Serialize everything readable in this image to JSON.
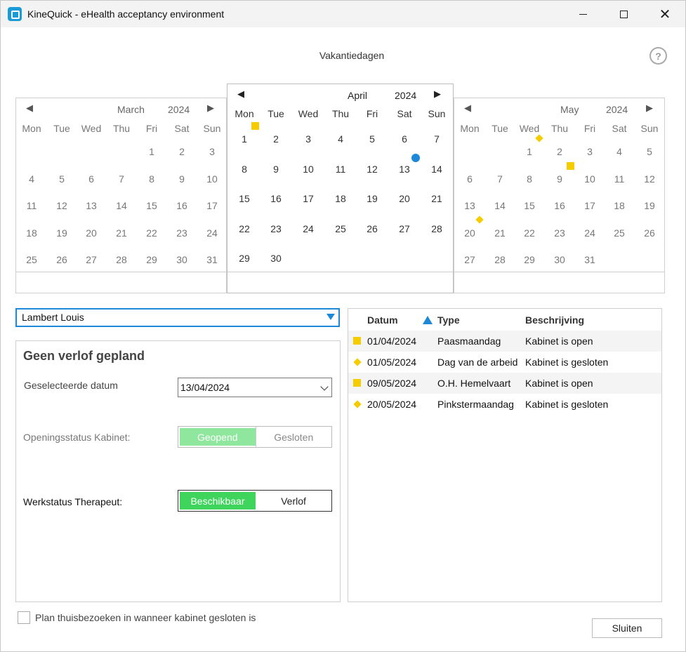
{
  "window": {
    "title": "KineQuick - eHealth acceptancy environment",
    "controls": {
      "minimize": "",
      "maximize": "",
      "close": "✕"
    }
  },
  "dialog": {
    "title": "Vakantiedagen",
    "help": "?"
  },
  "icons": {
    "app": "kinequick-app-icon",
    "help": "question-mark-icon",
    "prev": "triangle-left-icon",
    "next": "triangle-right-icon",
    "dropdown": "triangle-down-icon",
    "sort": "triangle-up-icon"
  },
  "colors": {
    "holiday_open": "#f5cc00",
    "holiday_closed": "#f5cc00",
    "selected_date": "#1e88d8",
    "accent": "#1e88d8",
    "available": "#3fd45c",
    "open_disabled": "#8ee79d"
  },
  "calendar": {
    "prev": "◀",
    "next": "▶",
    "weekdays": [
      "Mon",
      "Tue",
      "Wed",
      "Thu",
      "Fri",
      "Sat",
      "Sun"
    ],
    "months": [
      {
        "month": "March",
        "year": "2024",
        "first_weekday": 4,
        "days": 31,
        "marks": []
      },
      {
        "month": "April",
        "year": "2024",
        "first_weekday": 0,
        "days": 30,
        "marks": [
          {
            "day": 1,
            "kind": "square"
          },
          {
            "day": 13,
            "kind": "dot"
          }
        ]
      },
      {
        "month": "May",
        "year": "2024",
        "first_weekday": 2,
        "days": 31,
        "marks": [
          {
            "day": 1,
            "kind": "diamond"
          },
          {
            "day": 9,
            "kind": "square"
          },
          {
            "day": 20,
            "kind": "diamond"
          }
        ]
      }
    ]
  },
  "therapist": {
    "selected": "Lambert Louis"
  },
  "detail": {
    "heading": "Geen verlof gepland",
    "selected_date_label": "Geselecteerde datum",
    "selected_date_value": "13/04/2024",
    "opening_label": "Openingsstatus Kabinet:",
    "opening_on": "Geopend",
    "opening_off": "Gesloten",
    "work_label": "Werkstatus Therapeut:",
    "work_on": "Beschikbaar",
    "work_off": "Verlof"
  },
  "table": {
    "headers": {
      "date": "Datum",
      "type": "Type",
      "description": "Beschrijving"
    },
    "rows": [
      {
        "mark": "square",
        "date": "01/04/2024",
        "type": "Paasmaandag",
        "description": "Kabinet is open"
      },
      {
        "mark": "diamond",
        "date": "01/05/2024",
        "type": "Dag van de arbeid",
        "description": "Kabinet is gesloten"
      },
      {
        "mark": "square",
        "date": "09/05/2024",
        "type": "O.H. Hemelvaart",
        "description": "Kabinet is open"
      },
      {
        "mark": "diamond",
        "date": "20/05/2024",
        "type": "Pinkstermaandag",
        "description": "Kabinet is gesloten"
      }
    ]
  },
  "footer": {
    "home_visits_label": "Plan thuisbezoeken in wanneer kabinet gesloten is",
    "home_visits_checked": false,
    "close_label": "Sluiten"
  }
}
